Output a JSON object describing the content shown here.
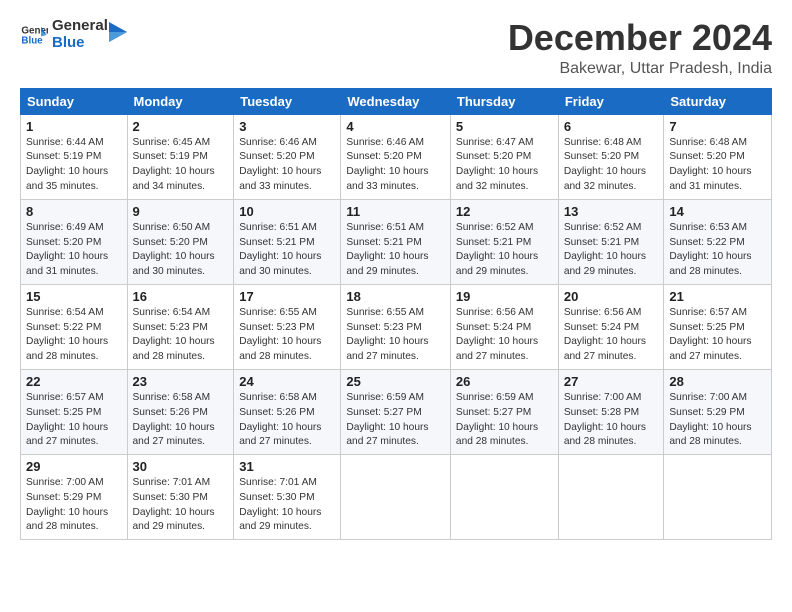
{
  "logo": {
    "text_general": "General",
    "text_blue": "Blue"
  },
  "header": {
    "month_year": "December 2024",
    "location": "Bakewar, Uttar Pradesh, India"
  },
  "weekdays": [
    "Sunday",
    "Monday",
    "Tuesday",
    "Wednesday",
    "Thursday",
    "Friday",
    "Saturday"
  ],
  "weeks": [
    [
      {
        "day": "1",
        "sunrise": "Sunrise: 6:44 AM",
        "sunset": "Sunset: 5:19 PM",
        "daylight": "Daylight: 10 hours and 35 minutes."
      },
      {
        "day": "2",
        "sunrise": "Sunrise: 6:45 AM",
        "sunset": "Sunset: 5:19 PM",
        "daylight": "Daylight: 10 hours and 34 minutes."
      },
      {
        "day": "3",
        "sunrise": "Sunrise: 6:46 AM",
        "sunset": "Sunset: 5:20 PM",
        "daylight": "Daylight: 10 hours and 33 minutes."
      },
      {
        "day": "4",
        "sunrise": "Sunrise: 6:46 AM",
        "sunset": "Sunset: 5:20 PM",
        "daylight": "Daylight: 10 hours and 33 minutes."
      },
      {
        "day": "5",
        "sunrise": "Sunrise: 6:47 AM",
        "sunset": "Sunset: 5:20 PM",
        "daylight": "Daylight: 10 hours and 32 minutes."
      },
      {
        "day": "6",
        "sunrise": "Sunrise: 6:48 AM",
        "sunset": "Sunset: 5:20 PM",
        "daylight": "Daylight: 10 hours and 32 minutes."
      },
      {
        "day": "7",
        "sunrise": "Sunrise: 6:48 AM",
        "sunset": "Sunset: 5:20 PM",
        "daylight": "Daylight: 10 hours and 31 minutes."
      }
    ],
    [
      {
        "day": "8",
        "sunrise": "Sunrise: 6:49 AM",
        "sunset": "Sunset: 5:20 PM",
        "daylight": "Daylight: 10 hours and 31 minutes."
      },
      {
        "day": "9",
        "sunrise": "Sunrise: 6:50 AM",
        "sunset": "Sunset: 5:20 PM",
        "daylight": "Daylight: 10 hours and 30 minutes."
      },
      {
        "day": "10",
        "sunrise": "Sunrise: 6:51 AM",
        "sunset": "Sunset: 5:21 PM",
        "daylight": "Daylight: 10 hours and 30 minutes."
      },
      {
        "day": "11",
        "sunrise": "Sunrise: 6:51 AM",
        "sunset": "Sunset: 5:21 PM",
        "daylight": "Daylight: 10 hours and 29 minutes."
      },
      {
        "day": "12",
        "sunrise": "Sunrise: 6:52 AM",
        "sunset": "Sunset: 5:21 PM",
        "daylight": "Daylight: 10 hours and 29 minutes."
      },
      {
        "day": "13",
        "sunrise": "Sunrise: 6:52 AM",
        "sunset": "Sunset: 5:21 PM",
        "daylight": "Daylight: 10 hours and 29 minutes."
      },
      {
        "day": "14",
        "sunrise": "Sunrise: 6:53 AM",
        "sunset": "Sunset: 5:22 PM",
        "daylight": "Daylight: 10 hours and 28 minutes."
      }
    ],
    [
      {
        "day": "15",
        "sunrise": "Sunrise: 6:54 AM",
        "sunset": "Sunset: 5:22 PM",
        "daylight": "Daylight: 10 hours and 28 minutes."
      },
      {
        "day": "16",
        "sunrise": "Sunrise: 6:54 AM",
        "sunset": "Sunset: 5:23 PM",
        "daylight": "Daylight: 10 hours and 28 minutes."
      },
      {
        "day": "17",
        "sunrise": "Sunrise: 6:55 AM",
        "sunset": "Sunset: 5:23 PM",
        "daylight": "Daylight: 10 hours and 28 minutes."
      },
      {
        "day": "18",
        "sunrise": "Sunrise: 6:55 AM",
        "sunset": "Sunset: 5:23 PM",
        "daylight": "Daylight: 10 hours and 27 minutes."
      },
      {
        "day": "19",
        "sunrise": "Sunrise: 6:56 AM",
        "sunset": "Sunset: 5:24 PM",
        "daylight": "Daylight: 10 hours and 27 minutes."
      },
      {
        "day": "20",
        "sunrise": "Sunrise: 6:56 AM",
        "sunset": "Sunset: 5:24 PM",
        "daylight": "Daylight: 10 hours and 27 minutes."
      },
      {
        "day": "21",
        "sunrise": "Sunrise: 6:57 AM",
        "sunset": "Sunset: 5:25 PM",
        "daylight": "Daylight: 10 hours and 27 minutes."
      }
    ],
    [
      {
        "day": "22",
        "sunrise": "Sunrise: 6:57 AM",
        "sunset": "Sunset: 5:25 PM",
        "daylight": "Daylight: 10 hours and 27 minutes."
      },
      {
        "day": "23",
        "sunrise": "Sunrise: 6:58 AM",
        "sunset": "Sunset: 5:26 PM",
        "daylight": "Daylight: 10 hours and 27 minutes."
      },
      {
        "day": "24",
        "sunrise": "Sunrise: 6:58 AM",
        "sunset": "Sunset: 5:26 PM",
        "daylight": "Daylight: 10 hours and 27 minutes."
      },
      {
        "day": "25",
        "sunrise": "Sunrise: 6:59 AM",
        "sunset": "Sunset: 5:27 PM",
        "daylight": "Daylight: 10 hours and 27 minutes."
      },
      {
        "day": "26",
        "sunrise": "Sunrise: 6:59 AM",
        "sunset": "Sunset: 5:27 PM",
        "daylight": "Daylight: 10 hours and 28 minutes."
      },
      {
        "day": "27",
        "sunrise": "Sunrise: 7:00 AM",
        "sunset": "Sunset: 5:28 PM",
        "daylight": "Daylight: 10 hours and 28 minutes."
      },
      {
        "day": "28",
        "sunrise": "Sunrise: 7:00 AM",
        "sunset": "Sunset: 5:29 PM",
        "daylight": "Daylight: 10 hours and 28 minutes."
      }
    ],
    [
      {
        "day": "29",
        "sunrise": "Sunrise: 7:00 AM",
        "sunset": "Sunset: 5:29 PM",
        "daylight": "Daylight: 10 hours and 28 minutes."
      },
      {
        "day": "30",
        "sunrise": "Sunrise: 7:01 AM",
        "sunset": "Sunset: 5:30 PM",
        "daylight": "Daylight: 10 hours and 29 minutes."
      },
      {
        "day": "31",
        "sunrise": "Sunrise: 7:01 AM",
        "sunset": "Sunset: 5:30 PM",
        "daylight": "Daylight: 10 hours and 29 minutes."
      },
      null,
      null,
      null,
      null
    ]
  ]
}
